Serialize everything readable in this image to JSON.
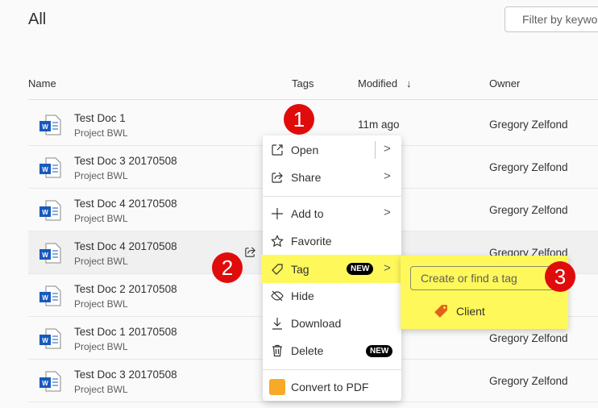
{
  "header": {
    "title": "All",
    "filter_placeholder": "Filter by keyword"
  },
  "columns": {
    "name": "Name",
    "tags": "Tags",
    "modified": "Modified",
    "modified_sort": "↓",
    "owner": "Owner"
  },
  "rows": [
    {
      "name": "Test Doc 1",
      "location": "Project BWL",
      "modified": "11m ago",
      "owner": "Gregory Zelfond"
    },
    {
      "name": "Test Doc 3 20170508",
      "location": "Project BWL",
      "modified": "",
      "owner": "Gregory Zelfond"
    },
    {
      "name": "Test Doc 4 20170508",
      "location": "Project BWL",
      "modified": "",
      "owner": "Gregory Zelfond"
    },
    {
      "name": "Test Doc 4 20170508",
      "location": "Project BWL",
      "modified": "",
      "owner": "Gregory Zelfond"
    },
    {
      "name": "Test Doc 2 20170508",
      "location": "Project BWL",
      "modified": "",
      "owner": "Gregory Zelfond"
    },
    {
      "name": "Test Doc 1 20170508",
      "location": "Project BWL",
      "modified": "",
      "owner": "Gregory Zelfond"
    },
    {
      "name": "Test Doc 3 20170508",
      "location": "Project BWL",
      "modified": "",
      "owner": "Gregory Zelfond"
    }
  ],
  "menu": {
    "open": "Open",
    "share": "Share",
    "add_to": "Add to",
    "favorite": "Favorite",
    "tag": "Tag",
    "tag_badge": "NEW",
    "hide": "Hide",
    "download": "Download",
    "delete": "Delete",
    "delete_badge": "NEW",
    "convert": "Convert to PDF"
  },
  "submenu": {
    "placeholder": "Create or find a tag",
    "tags": [
      "Client"
    ]
  },
  "callouts": [
    "1",
    "2",
    "3"
  ],
  "colors": {
    "highlight": "#fef85a",
    "callout": "#e00c0c",
    "word": "#185abd",
    "tag": "#e0621a"
  }
}
